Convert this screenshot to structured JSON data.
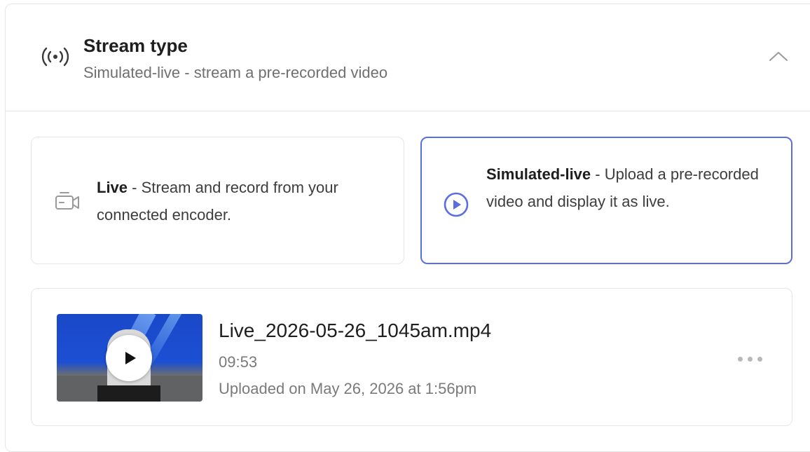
{
  "stream_type": {
    "title": "Stream type",
    "subtitle": "Simulated-live - stream a pre-recorded video",
    "header_icon": "broadcast-icon",
    "collapse_icon": "chevron-up-icon",
    "options": [
      {
        "label": "Live",
        "description": " - Stream and record from your connected encoder.",
        "icon": "camera-icon",
        "selected": false
      },
      {
        "label": "Simulated-live",
        "description": " - Upload a pre-recorded video and display it as live.",
        "icon": "play-circle-icon",
        "selected": true
      }
    ]
  },
  "video": {
    "filename": "Live_2026-05-26_1045am.mp4",
    "duration": "09:53",
    "uploaded": "Uploaded on May 26, 2026 at 1:56pm",
    "more_icon": "more-horizontal-icon",
    "play_icon": "play-icon"
  },
  "colors": {
    "accent": "#5b6ee1",
    "border": "#e5e5e5",
    "muted_text": "#707070"
  }
}
